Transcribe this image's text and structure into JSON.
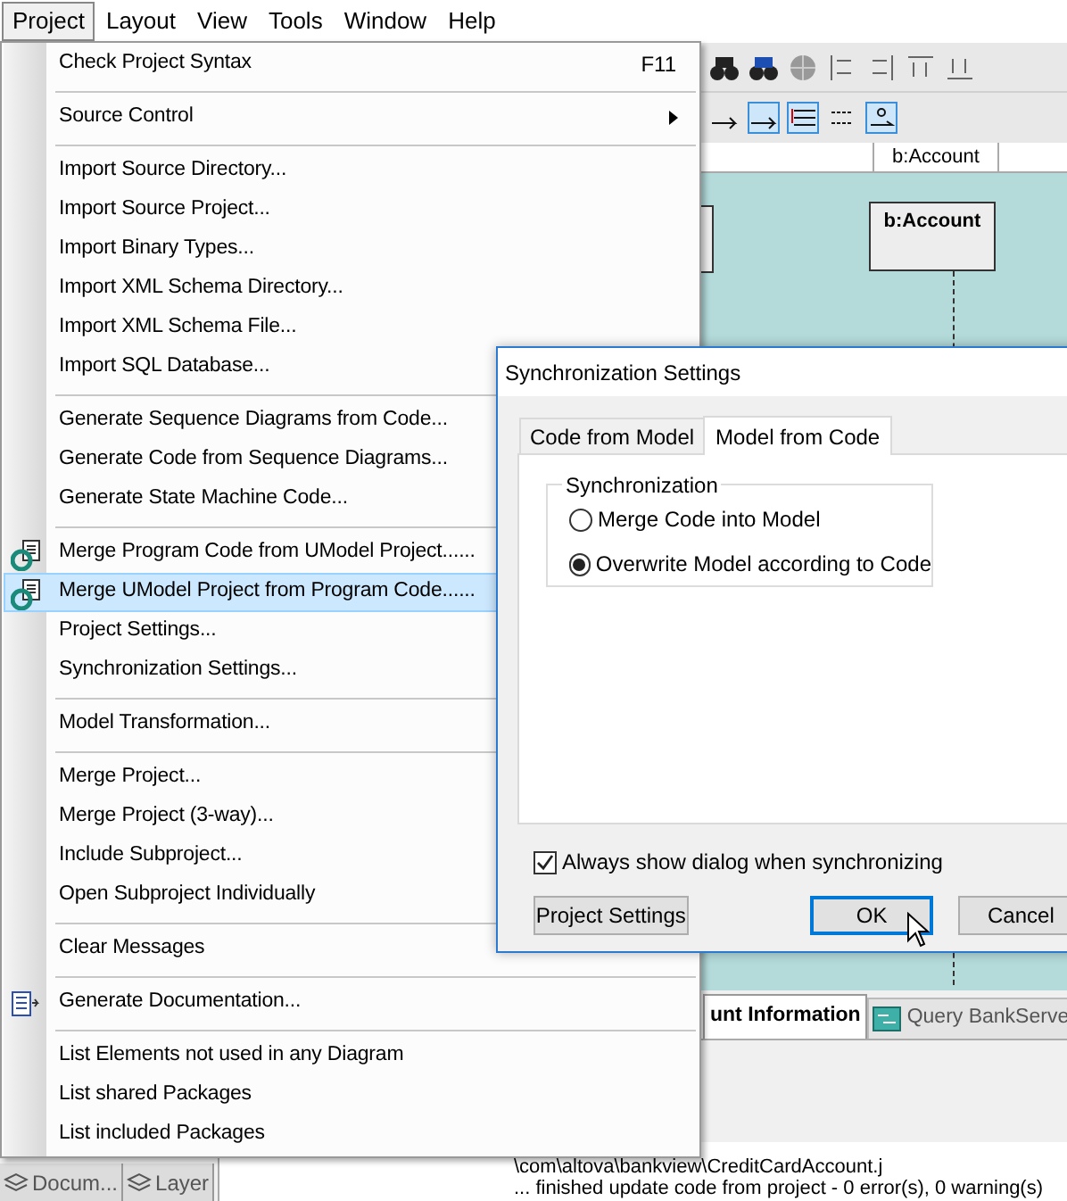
{
  "menu_bar": [
    {
      "label": "Project",
      "selected": true
    },
    {
      "label": "Layout",
      "selected": false
    },
    {
      "label": "View",
      "selected": false
    },
    {
      "label": "Tools",
      "selected": false
    },
    {
      "label": "Window",
      "selected": false
    },
    {
      "label": "Help",
      "selected": false
    }
  ],
  "diagram": {
    "header_cell": "b:Account",
    "lifeline": "b:Account"
  },
  "document_tabs": [
    {
      "label": "unt Information",
      "selected": true
    },
    {
      "label": "Query BankServe",
      "selected": false
    }
  ],
  "panel_tabs": [
    {
      "label": "Docum...",
      "selected": false
    },
    {
      "label": "Layer",
      "selected": false
    }
  ],
  "messages": [
    "\\com\\altova\\bankview\\CreditCardAccount.j",
    "... finished update code from project - 0 error(s), 0 warning(s)"
  ],
  "project_menu": [
    {
      "kind": "item",
      "label": "Check Project Syntax",
      "shortcut": "F11",
      "highlighted": false
    },
    {
      "kind": "separator"
    },
    {
      "kind": "submenu",
      "label": "Source Control",
      "highlighted": false
    },
    {
      "kind": "separator"
    },
    {
      "kind": "item",
      "label": "Import Source Directory...",
      "highlighted": false
    },
    {
      "kind": "item",
      "label": "Import Source Project...",
      "highlighted": false
    },
    {
      "kind": "item",
      "label": "Import Binary Types...",
      "highlighted": false
    },
    {
      "kind": "item",
      "label": "Import XML Schema Directory...",
      "highlighted": false
    },
    {
      "kind": "item",
      "label": "Import XML Schema File...",
      "highlighted": false
    },
    {
      "kind": "item",
      "label": "Import SQL Database...",
      "highlighted": false
    },
    {
      "kind": "separator"
    },
    {
      "kind": "item",
      "label": "Generate Sequence Diagrams from Code...",
      "highlighted": false
    },
    {
      "kind": "item",
      "label": "Generate Code from Sequence Diagrams...",
      "highlighted": false
    },
    {
      "kind": "item",
      "label": "Generate State Machine Code...",
      "highlighted": false
    },
    {
      "kind": "separator"
    },
    {
      "kind": "merge",
      "label": "Merge Program Code from UModel Project......",
      "highlighted": false
    },
    {
      "kind": "merge",
      "label": "Merge UModel Project from Program Code......",
      "highlighted": true
    },
    {
      "kind": "item",
      "label": "Project Settings...",
      "highlighted": false
    },
    {
      "kind": "item",
      "label": "Synchronization Settings...",
      "highlighted": false
    },
    {
      "kind": "separator"
    },
    {
      "kind": "item",
      "label": "Model Transformation...",
      "highlighted": false
    },
    {
      "kind": "separator"
    },
    {
      "kind": "item",
      "label": "Merge Project...",
      "highlighted": false
    },
    {
      "kind": "item",
      "label": "Merge Project (3-way)...",
      "highlighted": false
    },
    {
      "kind": "item",
      "label": "Include Subproject...",
      "highlighted": false
    },
    {
      "kind": "item",
      "label": "Open Subproject Individually",
      "highlighted": false
    },
    {
      "kind": "separator"
    },
    {
      "kind": "item",
      "label": "Clear Messages",
      "highlighted": false
    },
    {
      "kind": "separator"
    },
    {
      "kind": "document",
      "label": "Generate Documentation...",
      "highlighted": false
    },
    {
      "kind": "separator"
    },
    {
      "kind": "item",
      "label": "List Elements not used in any Diagram",
      "highlighted": false
    },
    {
      "kind": "item",
      "label": "List shared Packages",
      "highlighted": false
    },
    {
      "kind": "item",
      "label": "List included Packages",
      "highlighted": false
    }
  ],
  "dialog": {
    "title": "Synchronization Settings",
    "tabs": [
      {
        "label": "Code from Model",
        "selected": false
      },
      {
        "label": "Model from Code",
        "selected": true
      }
    ],
    "group": {
      "title": "Synchronization",
      "options": [
        {
          "label": "Merge Code into Model",
          "selected": false
        },
        {
          "label": "Overwrite Model according to Code",
          "selected": true
        }
      ]
    },
    "checkbox": {
      "label": "Always show dialog when synchronizing",
      "checked": true
    },
    "buttons": [
      {
        "label": "Project Settings",
        "default": false
      },
      {
        "label": "OK",
        "default": true
      },
      {
        "label": "Cancel",
        "default": false
      }
    ]
  }
}
